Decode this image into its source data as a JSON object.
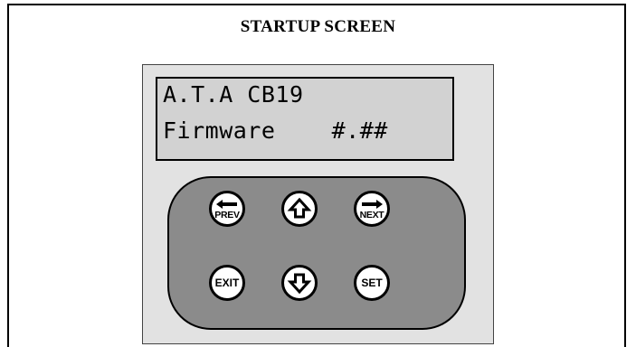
{
  "title": "STARTUP SCREEN",
  "lcd": {
    "line1": "A.T.A CB19",
    "line2": "Firmware    #.##"
  },
  "keys": {
    "prev": {
      "label": "PREV",
      "icon": "left-arrow-icon"
    },
    "up": {
      "icon": "up-arrow-icon"
    },
    "next": {
      "label": "NEXT",
      "icon": "right-arrow-icon"
    },
    "exit": {
      "label": "EXIT"
    },
    "down": {
      "icon": "down-arrow-icon"
    },
    "set": {
      "label": "SET"
    }
  },
  "colors": {
    "device_panel": "#e2e2e2",
    "lcd_background": "#d2d2d2",
    "keypad": "#8b8b8b",
    "key_face": "#ffffff"
  }
}
